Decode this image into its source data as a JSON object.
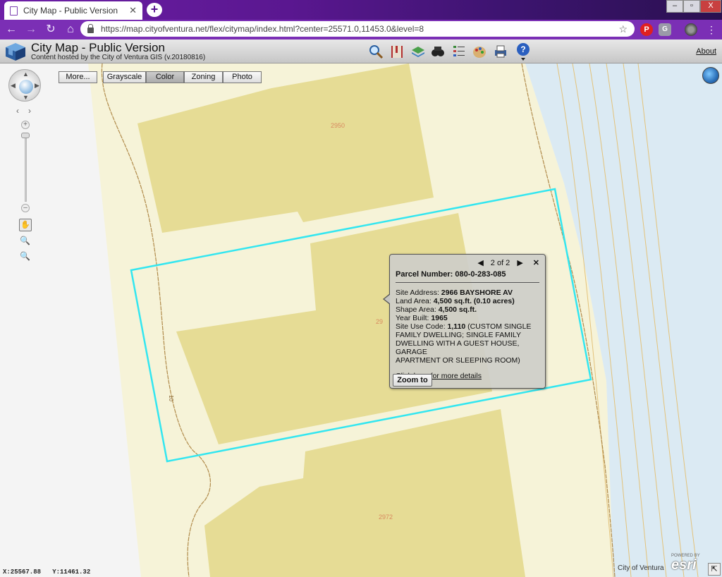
{
  "browser": {
    "tab_title": "City Map - Public Version",
    "tab_close": "✕",
    "new_tab": "+",
    "url": "https://map.cityofventura.net/flex/citymap/index.html?center=25571.0,11453.0&level=8",
    "window_min": "–",
    "window_max": "▫",
    "window_close": "X",
    "ext_pinterest": "P",
    "ext_g": "G",
    "menu": "⋮"
  },
  "app": {
    "title": "City Map - Public Version",
    "subtitle": "Content hosted by the City of Ventura GIS (v.20180816)",
    "about": "About",
    "tools": [
      "search-icon",
      "bookmark-icon",
      "layers-icon",
      "binoculars-icon",
      "legend-icon",
      "palette-icon",
      "print-icon",
      "help-icon"
    ]
  },
  "map_buttons": {
    "more": "More...",
    "grayscale": "Grayscale",
    "color": "Color",
    "zoning": "Zoning",
    "photo": "Photo"
  },
  "parcel_labels": {
    "top": "2950",
    "middle": "29",
    "bottom": "2972",
    "contour": "10"
  },
  "popup": {
    "counter": "2 of 2",
    "prev": "◀",
    "next": "▶",
    "close": "✕",
    "parcel_label": "Parcel Number:",
    "parcel_value": "080-0-283-085",
    "site_address_label": "Site Address:",
    "site_address_value": "2966 BAYSHORE AV",
    "land_area_label": "Land Area:",
    "land_area_value": "4,500 sq.ft. (0.10 acres)",
    "shape_area_label": "Shape Area:",
    "shape_area_value": "4,500 sq.ft.",
    "year_built_label": "Year Built:",
    "year_built_value": "1965",
    "use_code_label": "Site Use Code:",
    "use_code_value": "1,110",
    "use_code_desc_1": "(CUSTOM SINGLE",
    "use_code_desc_2": "FAMILY DWELLING; SINGLE FAMILY",
    "use_code_desc_3": "DWELLING WITH A GUEST HOUSE, GARAGE",
    "use_code_desc_4": "APARTMENT OR SLEEPING ROOM)",
    "details_link": "Click here for more details",
    "zoom_to": "Zoom to"
  },
  "footer": {
    "x_label": "X:25567.88",
    "y_label": "Y:11461.32",
    "credit": "City of Ventura",
    "powered": "POWERED BY",
    "esri": "esri"
  },
  "colors": {
    "chrome_purple": "#7b2fb5",
    "parcel_fill": "#e8e0a0",
    "parcel_light": "#f5f2d8",
    "water": "#dcecf3",
    "selection": "#33e6f0",
    "contour": "#b08a4a"
  }
}
